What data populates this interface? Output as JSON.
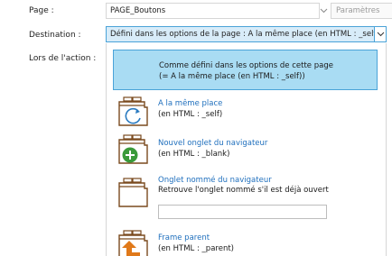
{
  "labels": {
    "page": "Page :",
    "destination": "Destination :",
    "action": "Lors de l'action :"
  },
  "page_field": {
    "value": "PAGE_Boutons"
  },
  "params_button": {
    "label": "Paramètres"
  },
  "destination_select": {
    "value": "Défini dans les options de la page : A la même place (en HTML : _self)"
  },
  "options": {
    "default": {
      "line1": "Comme défini dans les options de cette page",
      "line2": "(= A la même place (en HTML : _self))"
    },
    "self": {
      "title": "A la même place",
      "sub": "(en HTML : _self)"
    },
    "blank": {
      "title": "Nouvel onglet du navigateur",
      "sub": "(en HTML : _blank)"
    },
    "named": {
      "title": "Onglet nommé du navigateur",
      "sub": "Retrouve l'onglet nommé s'il est déjà ouvert",
      "input_value": ""
    },
    "parent": {
      "title": "Frame parent",
      "sub": "(en HTML : _parent)"
    }
  },
  "colors": {
    "selected_bg": "#a9dcf3",
    "selected_border": "#4aa3d8",
    "link": "#1f6fbd",
    "icon_brown": "#7a4a1e",
    "icon_green": "#3a9a3a",
    "icon_orange": "#e0791a"
  },
  "icons": {
    "self": "browser-window-refresh-icon",
    "blank": "browser-window-new-tab-icon",
    "named": "browser-window-named-icon",
    "parent": "browser-window-parent-icon",
    "dropdown": "chevron-down-icon"
  }
}
